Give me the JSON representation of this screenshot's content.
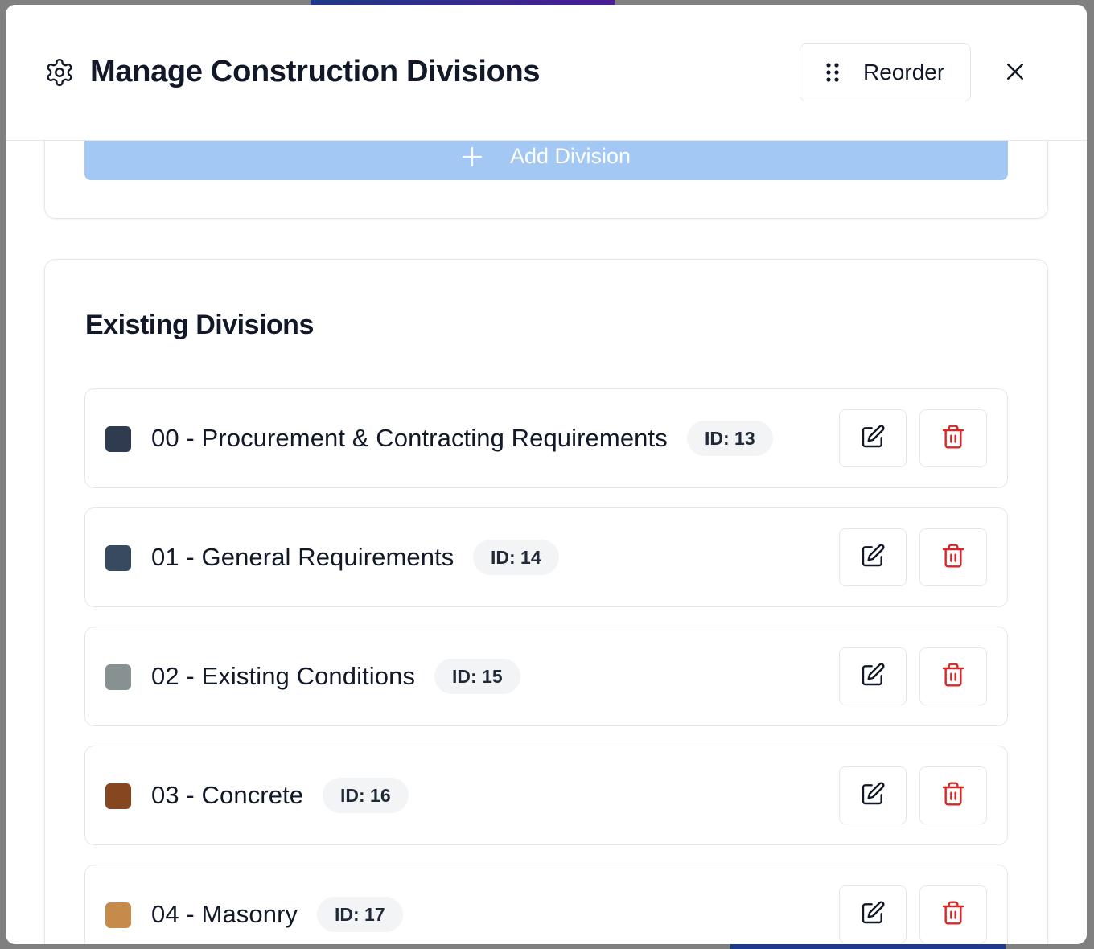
{
  "modal": {
    "title": "Manage Construction Divisions",
    "reorder_label": "Reorder",
    "close_label": "Close",
    "add_label": "Add Division"
  },
  "section": {
    "title": "Existing Divisions"
  },
  "divisions": [
    {
      "name": "00 - Procurement & Contracting Requirements",
      "id_label": "ID: 13",
      "color": "#2f3b4e"
    },
    {
      "name": "01 - General Requirements",
      "id_label": "ID: 14",
      "color": "#384a5f"
    },
    {
      "name": "02 - Existing Conditions",
      "id_label": "ID: 15",
      "color": "#879192"
    },
    {
      "name": "03 - Concrete",
      "id_label": "ID: 16",
      "color": "#864720"
    },
    {
      "name": "04 - Masonry",
      "id_label": "ID: 17",
      "color": "#c68a4b"
    }
  ],
  "colors": {
    "add_button": "#a3c8f4",
    "delete_icon": "#dc2626",
    "text": "#111827"
  }
}
